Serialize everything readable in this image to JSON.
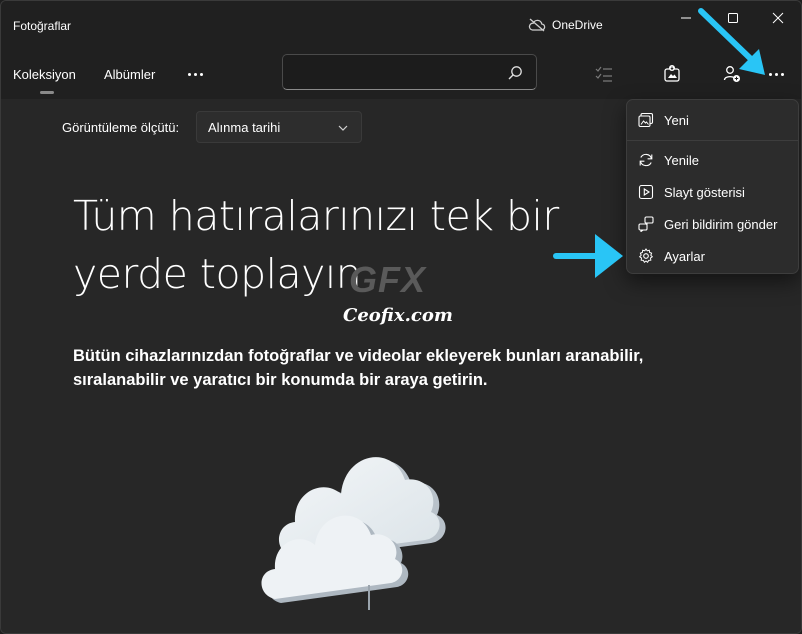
{
  "window": {
    "title": "Fotoğraflar",
    "onedrive_label": "OneDrive"
  },
  "nav": {
    "tabs": [
      {
        "label": "Koleksiyon",
        "active": true
      },
      {
        "label": "Albümler",
        "active": false
      }
    ],
    "more_icon": "ellipsis-icon",
    "search": {
      "value": "",
      "placeholder": ""
    },
    "toolbar_icons": [
      "select-icon",
      "import-icon",
      "add-people-icon",
      "more-icon"
    ]
  },
  "content": {
    "sort_label": "Görüntüleme ölçütü:",
    "sort_value": "Alınma tarihi",
    "headline": "Tüm hatıralarınızı tek bir yerde toplayın",
    "subtext": "Bütün cihazlarınızdan fotoğraflar ve videolar ekleyerek bunları aranabilir, sıralanabilir ve yaratıcı bir konumda bir araya getirin.",
    "watermark_logo": "GFX",
    "watermark_text": "Ceofix.com"
  },
  "menu": {
    "items": [
      {
        "label": "Yeni",
        "icon": "new-image-icon"
      },
      {
        "label": "Yenile",
        "icon": "refresh-icon"
      },
      {
        "label": "Slayt gösterisi",
        "icon": "slideshow-icon"
      },
      {
        "label": "Geri bildirim gönder",
        "icon": "feedback-icon"
      },
      {
        "label": "Ayarlar",
        "icon": "gear-icon"
      }
    ]
  },
  "colors": {
    "background": "#272727",
    "titlebar": "#202020",
    "menu_bg": "#2c2c2c",
    "annotation_arrow": "#29c5f6"
  }
}
